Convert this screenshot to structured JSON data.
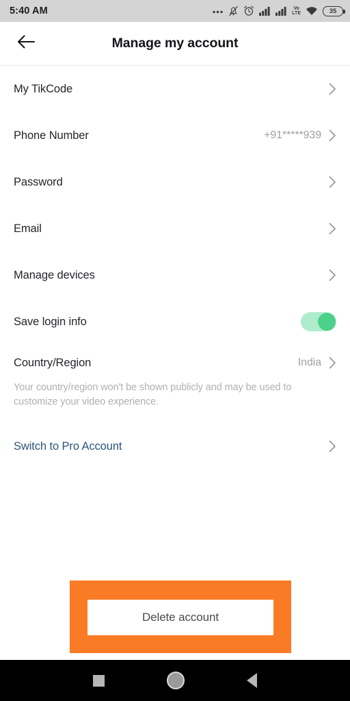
{
  "status_bar": {
    "time": "5:40 AM",
    "icons": [
      "more-dots-icon",
      "bell-muted-icon",
      "alarm-clock-icon",
      "signal-bars-icon",
      "signal-bars-icon",
      "volte-icon",
      "wifi-icon",
      "battery-icon"
    ],
    "volte_label": "Vo\nLTE",
    "volte_top": "Vo",
    "volte_bottom": "LTE",
    "battery_level": "35"
  },
  "header": {
    "back_icon": "arrow-left-icon",
    "title": "Manage my account"
  },
  "settings": {
    "rows": [
      {
        "label": "My TikCode",
        "value": "",
        "type": "chevron"
      },
      {
        "label": "Phone Number",
        "value": "+91*****939",
        "type": "chevron"
      },
      {
        "label": "Password",
        "value": "",
        "type": "chevron"
      },
      {
        "label": "Email",
        "value": "",
        "type": "chevron"
      },
      {
        "label": "Manage devices",
        "value": "",
        "type": "chevron"
      },
      {
        "label": "Save login info",
        "value": "on",
        "type": "toggle"
      }
    ],
    "country": {
      "label": "Country/Region",
      "value": "India",
      "description": "Your country/region won't be shown publicly and may be used to customize your video experience."
    },
    "pro_account": {
      "label": "Switch to Pro Account"
    }
  },
  "delete": {
    "label": "Delete account",
    "annotation_color": "#f97b25"
  },
  "nav_bar": {
    "recents": "square-recents-icon",
    "home": "circle-home-icon",
    "back": "triangle-back-icon"
  },
  "colors": {
    "accent_green": "#4dd08a",
    "track_green": "#aeeccd",
    "pro_blue": "#2c5578",
    "annotation_orange": "#f97b25"
  }
}
